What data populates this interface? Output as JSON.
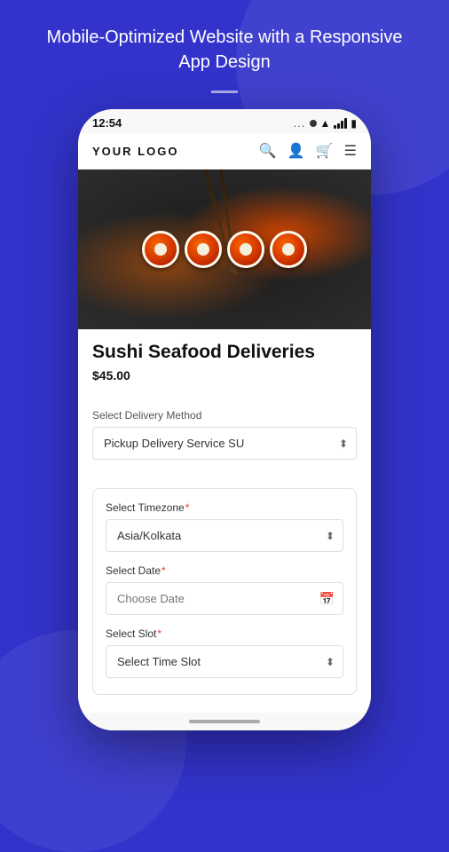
{
  "page": {
    "background_color": "#3333cc",
    "header": {
      "title": "Mobile-Optimized Website with a Responsive App Design"
    }
  },
  "phone": {
    "status_bar": {
      "time": "12:54",
      "dots": "...",
      "signal_label": "signal",
      "wifi_label": "wifi",
      "battery_label": "battery"
    },
    "nav": {
      "logo": "YOUR LOGO",
      "search_icon": "search",
      "user_icon": "user",
      "cart_icon": "cart",
      "menu_icon": "menu"
    },
    "product": {
      "title": "Sushi Seafood Deliveries",
      "price": "$45.00"
    },
    "form": {
      "delivery_label": "Select Delivery Method",
      "delivery_value": "Pickup Delivery Service SU",
      "card": {
        "timezone_label": "Select Timezone",
        "timezone_required": true,
        "timezone_value": "Asia/Kolkata",
        "date_label": "Select Date",
        "date_required": true,
        "date_placeholder": "Choose Date",
        "slot_label": "Select Slot",
        "slot_required": true,
        "slot_placeholder": "Select Time Slot"
      }
    }
  }
}
